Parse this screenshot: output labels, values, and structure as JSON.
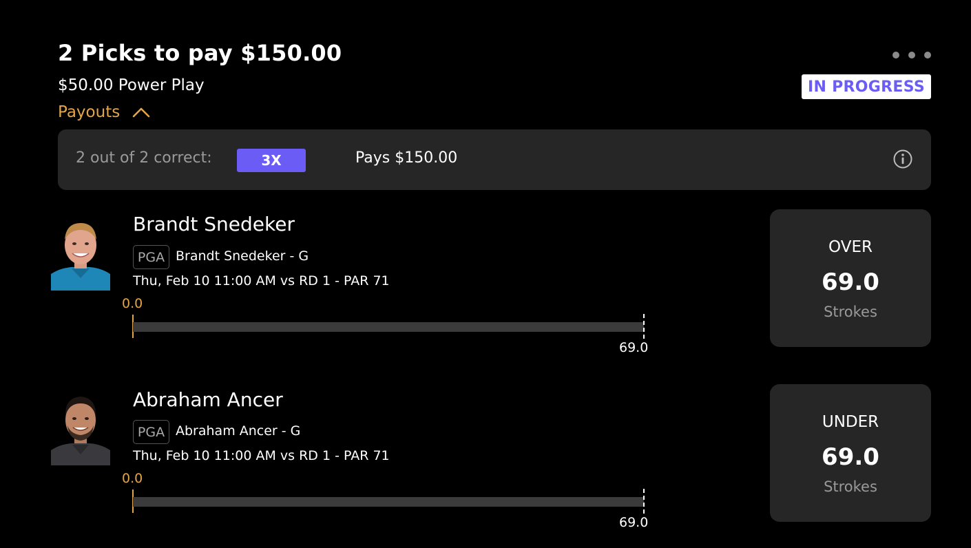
{
  "header": {
    "title": "2 Picks to pay $150.00",
    "subtitle": "$50.00 Power Play",
    "status": "IN PROGRESS",
    "payouts_label": "Payouts"
  },
  "payouts": {
    "correct_label": "2 out of 2 correct:",
    "multiplier": "3X",
    "pays": "Pays $150.00"
  },
  "picks": [
    {
      "name": "Brandt Snedeker",
      "league": "PGA",
      "meta": "Brandt Snedeker - G",
      "game": "Thu, Feb 10 11:00 AM vs RD 1 - PAR 71",
      "current": "0.0",
      "current_value": 0,
      "line_value": 69,
      "line": "69.0",
      "direction": "OVER",
      "stat": "Strokes"
    },
    {
      "name": "Abraham Ancer",
      "league": "PGA",
      "meta": "Abraham Ancer - G",
      "game": "Thu, Feb 10 11:00 AM vs RD 1 - PAR 71",
      "current": "0.0",
      "current_value": 0,
      "line_value": 69,
      "line": "69.0",
      "direction": "UNDER",
      "stat": "Strokes"
    }
  ],
  "colors": {
    "accent_gold": "#e3a54a",
    "accent_purple": "#6b5cf6",
    "panel": "#262626"
  }
}
